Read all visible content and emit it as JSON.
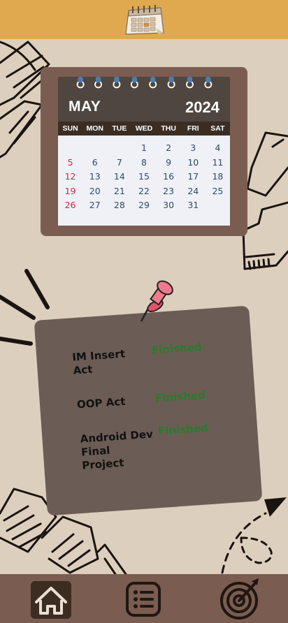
{
  "header": {
    "icon": "calendar-icon"
  },
  "calendar": {
    "month": "MAY",
    "year": "2024",
    "weekdays": [
      "SUN",
      "MON",
      "TUE",
      "WED",
      "THU",
      "FRI",
      "SAT"
    ],
    "rows": [
      [
        "",
        "",
        "",
        "1",
        "2",
        "3",
        "4"
      ],
      [
        "5",
        "6",
        "7",
        "8",
        "9",
        "10",
        "11"
      ],
      [
        "12",
        "13",
        "14",
        "15",
        "16",
        "17",
        "18"
      ],
      [
        "19",
        "20",
        "21",
        "22",
        "23",
        "24",
        "25"
      ],
      [
        "26",
        "27",
        "28",
        "29",
        "30",
        "31",
        ""
      ]
    ],
    "colors": {
      "sunday": "#d6283a",
      "day": "#2e4a6b",
      "ring": "#4a7db2"
    }
  },
  "tasks": [
    {
      "name": "IM Insert\nAct",
      "status": "Finished"
    },
    {
      "name": "OOP Act",
      "status": "Finished"
    },
    {
      "name": "Android Dev\nFinal\nProject",
      "status": "Finished"
    }
  ],
  "nav": {
    "items": [
      {
        "icon": "home-icon",
        "active": true
      },
      {
        "icon": "list-icon",
        "active": false
      },
      {
        "icon": "target-icon",
        "active": false
      }
    ]
  },
  "colors": {
    "background": "#ddcfbd",
    "header": "#e1a94f",
    "nav": "#7a5d50",
    "note": "#6b5d55",
    "finished": "#2b7a2b"
  }
}
